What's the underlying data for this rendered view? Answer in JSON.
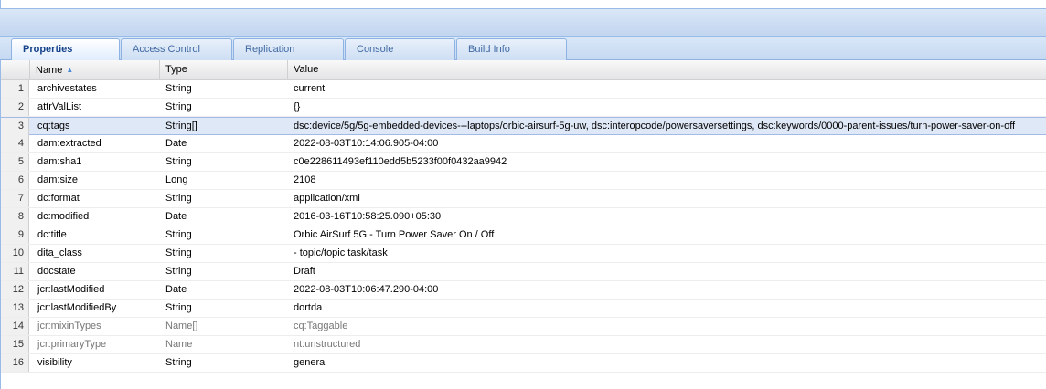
{
  "tabs": [
    {
      "label": "Properties",
      "active": true
    },
    {
      "label": "Access Control",
      "active": false
    },
    {
      "label": "Replication",
      "active": false
    },
    {
      "label": "Console",
      "active": false
    },
    {
      "label": "Build Info",
      "active": false
    }
  ],
  "grid": {
    "columns": {
      "name": "Name",
      "type": "Type",
      "value": "Value"
    },
    "sort": {
      "column": "Name",
      "direction": "ascending",
      "icon": "sort-asc-icon"
    },
    "selected_row": 3,
    "rows": [
      {
        "num": "1",
        "name": "archivestates",
        "type": "String",
        "value": "current"
      },
      {
        "num": "2",
        "name": "attrValList",
        "type": "String",
        "value": "{}"
      },
      {
        "num": "3",
        "name": "cq:tags",
        "type": "String[]",
        "value": "dsc:device/5g/5g-embedded-devices---laptops/orbic-airsurf-5g-uw, dsc:interopcode/powersaversettings, dsc:keywords/0000-parent-issues/turn-power-saver-on-off"
      },
      {
        "num": "4",
        "name": "dam:extracted",
        "type": "Date",
        "value": "2022-08-03T10:14:06.905-04:00"
      },
      {
        "num": "5",
        "name": "dam:sha1",
        "type": "String",
        "value": "c0e228611493ef110edd5b5233f00f0432aa9942"
      },
      {
        "num": "6",
        "name": "dam:size",
        "type": "Long",
        "value": "2108"
      },
      {
        "num": "7",
        "name": "dc:format",
        "type": "String",
        "value": "application/xml"
      },
      {
        "num": "8",
        "name": "dc:modified",
        "type": "Date",
        "value": "2016-03-16T10:58:25.090+05:30"
      },
      {
        "num": "9",
        "name": "dc:title",
        "type": "String",
        "value": "Orbic AirSurf 5G - Turn Power Saver On / Off"
      },
      {
        "num": "10",
        "name": "dita_class",
        "type": "String",
        "value": "- topic/topic task/task"
      },
      {
        "num": "11",
        "name": "docstate",
        "type": "String",
        "value": "Draft"
      },
      {
        "num": "12",
        "name": "jcr:lastModified",
        "type": "Date",
        "value": "2022-08-03T10:06:47.290-04:00"
      },
      {
        "num": "13",
        "name": "jcr:lastModifiedBy",
        "type": "String",
        "value": "dortda"
      },
      {
        "num": "14",
        "name": "jcr:mixinTypes",
        "type": "Name[]",
        "value": "cq:Taggable"
      },
      {
        "num": "15",
        "name": "jcr:primaryType",
        "type": "Name",
        "value": "nt:unstructured"
      },
      {
        "num": "16",
        "name": "visibility",
        "type": "String",
        "value": "general"
      }
    ]
  },
  "colors": {
    "accent": "#15428b",
    "selected_row": "#dfe8f6",
    "tab_border": "#8db2e3"
  }
}
